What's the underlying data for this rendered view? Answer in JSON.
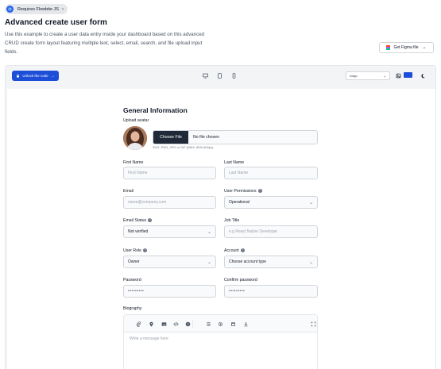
{
  "badge": {
    "label": "Requires Flowbite JS"
  },
  "header": {
    "title": "Advanced create user form",
    "description": "Use this example to create a user data entry inside your dashboard based on this advanced CRUD create form layout featuring multiple text, select, email, search, and file upload input fields."
  },
  "figma": {
    "label": "Get Figma file"
  },
  "toolbar": {
    "unlock_label": "Unlock the code",
    "theme_value": "Indigo",
    "accent_color": "#1d4ed8"
  },
  "form": {
    "title": "General Information",
    "avatar_label": "Upload avatar",
    "file_button": "Choose File",
    "file_status": "No file chosen",
    "file_hint": "SVG, PNG, JPG or GIF (MAX. 800×400px).",
    "first_name": {
      "label": "First Name",
      "placeholder": "First Name"
    },
    "last_name": {
      "label": "Last Name",
      "placeholder": "Last Name"
    },
    "email": {
      "label": "Email",
      "placeholder": "name@company.com"
    },
    "permissions": {
      "label": "User Permissions",
      "value": "Operational"
    },
    "email_status": {
      "label": "Email Status",
      "value": "Not verified"
    },
    "job_title": {
      "label": "Job Title",
      "placeholder": "e.g React Native Developer"
    },
    "user_role": {
      "label": "User Role",
      "value": "Owner"
    },
    "account": {
      "label": "Account",
      "value": "Choose account type"
    },
    "password": {
      "label": "Password",
      "value": "•••••••••"
    },
    "confirm_password": {
      "label": "Confirm password",
      "value": "•••••••••"
    },
    "biography": {
      "label": "Biography",
      "placeholder": "Write a message here"
    }
  }
}
